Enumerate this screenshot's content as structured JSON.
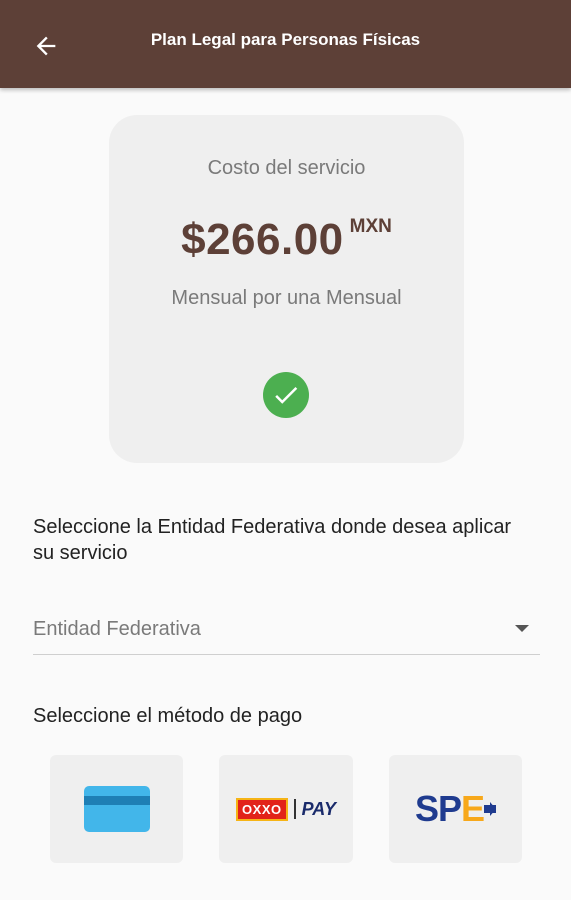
{
  "header": {
    "title": "Plan Legal para Personas Físicas",
    "back_icon": "arrow-back-icon"
  },
  "price_card": {
    "label": "Costo del servicio",
    "amount": "$266.00",
    "currency": "MXN",
    "period": "Mensual por una Mensual",
    "check_icon": "check-circle-icon",
    "check_color": "#4caf50"
  },
  "entity_section": {
    "prompt": "Seleccione la Entidad Federativa donde desea aplicar su servicio",
    "select_placeholder": "Entidad Federativa"
  },
  "payment_section": {
    "label": "Seleccione el método de pago",
    "options": [
      {
        "name": "Tarjeta",
        "icon": "credit-card-icon"
      },
      {
        "name_logo": "OXXO",
        "name_pay": "PAY",
        "icon": "oxxo-pay-logo"
      },
      {
        "name_logo": "SPE",
        "icon": "spei-logo"
      }
    ]
  },
  "colors": {
    "appbar": "#5d4037",
    "price": "#5d4037",
    "background": "#fafafa"
  }
}
